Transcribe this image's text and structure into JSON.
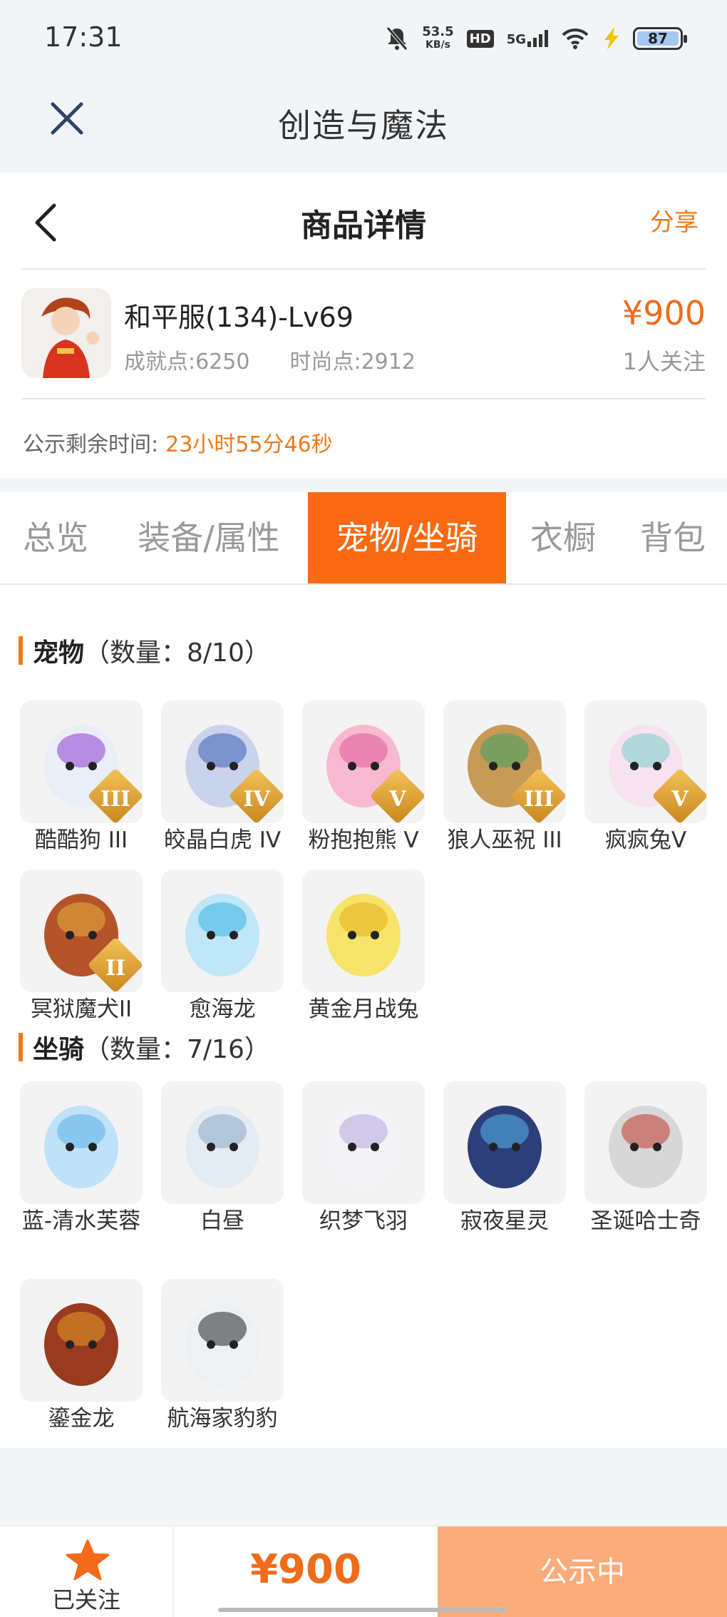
{
  "status": {
    "time": "17:31",
    "speed_top": "53.5",
    "speed_unit": "KB/s",
    "hd": "HD",
    "net": "5G",
    "battery": "87"
  },
  "app": {
    "title": "创造与魔法"
  },
  "nav": {
    "title": "商品详情",
    "share": "分享"
  },
  "product": {
    "name": "和平服(134)-Lv69",
    "achievement": "成就点:6250",
    "fashion": "时尚点:2912",
    "price": "¥900",
    "followers": "1人关注"
  },
  "timer": {
    "label": "公示剩余时间:",
    "value": "23小时55分46秒"
  },
  "tabs": [
    "总览",
    "装备/属性",
    "宠物/坐骑",
    "衣橱",
    "背包"
  ],
  "pets": {
    "title": "宠物",
    "count": "（数量：8/10）",
    "items": [
      {
        "name": "酷酷狗 III",
        "badge": "III",
        "color": "#e9eef8",
        "accent": "#8b3fd1"
      },
      {
        "name": "皎晶白虎 IV",
        "badge": "IV",
        "color": "#c9d3ec",
        "accent": "#3b5fb8"
      },
      {
        "name": "粉抱抱熊 V",
        "badge": "V",
        "color": "#f6b9d0",
        "accent": "#e25a9a"
      },
      {
        "name": "狼人巫祝 III",
        "badge": "III",
        "color": "#c79a55",
        "accent": "#3da36a"
      },
      {
        "name": "疯疯兔V",
        "badge": "V",
        "color": "#f7e3ef",
        "accent": "#7bd0c8"
      },
      {
        "name": "冥狱魔犬II",
        "badge": "II",
        "color": "#b5532b",
        "accent": "#e3b340"
      },
      {
        "name": "愈海龙",
        "badge": "",
        "color": "#bfe7f7",
        "accent": "#3bb4e6"
      },
      {
        "name": "黄金月战兔",
        "badge": "",
        "color": "#f7e36a",
        "accent": "#e2b117"
      }
    ]
  },
  "mounts": {
    "title": "坐骑",
    "count": "（数量：7/16）",
    "items": [
      {
        "name": "蓝-清水芙蓉",
        "color": "#bfe2f8",
        "accent": "#5fb1e6"
      },
      {
        "name": "白昼",
        "color": "#e4ecf3",
        "accent": "#8aa9c4"
      },
      {
        "name": "织梦飞羽",
        "color": "#f4f4f8",
        "accent": "#b4a6dd"
      },
      {
        "name": "寂夜星灵",
        "color": "#2c3f7a",
        "accent": "#58b6ea"
      },
      {
        "name": "圣诞哈士奇",
        "color": "#d7d7d7",
        "accent": "#c03a2b"
      },
      {
        "name": "鎏金龙",
        "color": "#9a3a1e",
        "accent": "#e59a2a"
      },
      {
        "name": "航海家豹豹",
        "color": "#eef1f4",
        "accent": "#222222"
      }
    ]
  },
  "bottom": {
    "follow": "已关注",
    "price": "¥900",
    "status": "公示中"
  },
  "colors": {
    "accent": "#fa6a12",
    "price": "#f06b1a",
    "status_btn": "#fcac7a"
  }
}
